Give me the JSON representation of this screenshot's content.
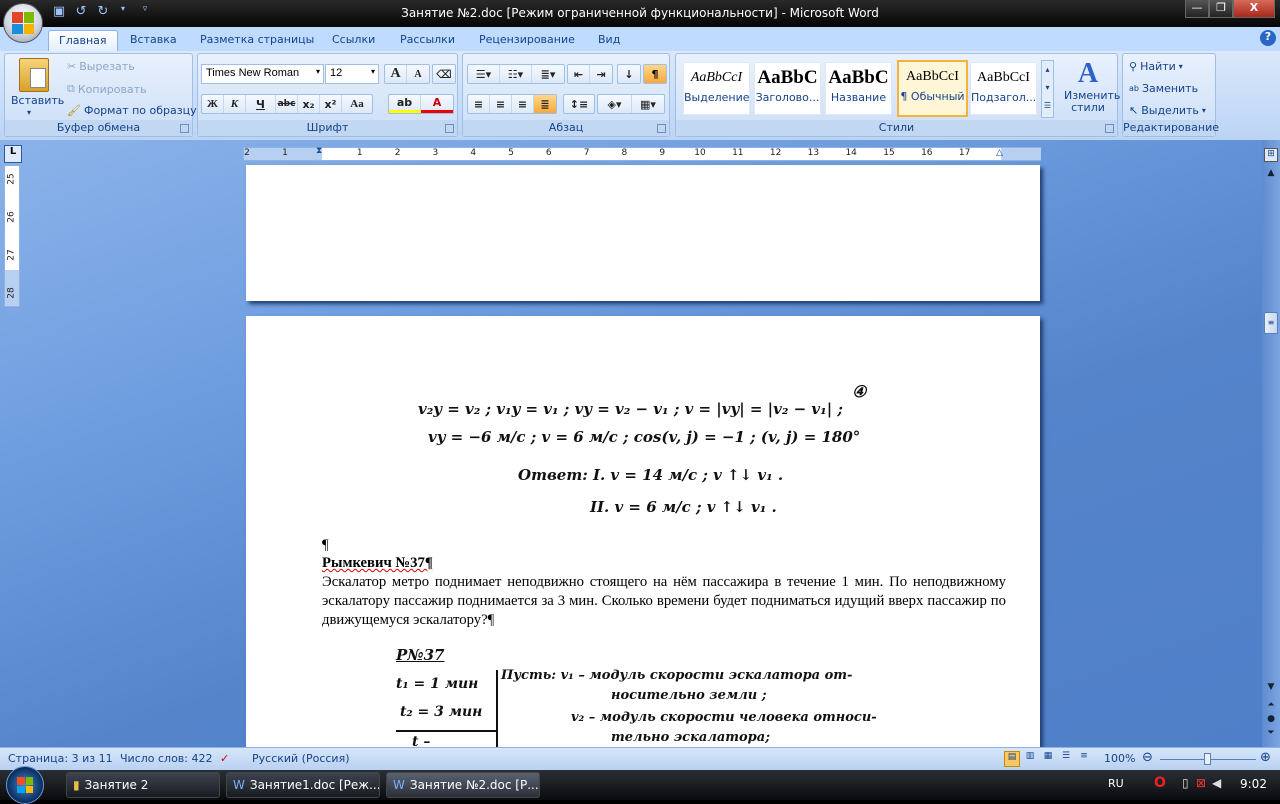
{
  "window": {
    "title": "Занятие №2.doc [Режим ограниченной функциональности] - Microsoft Word",
    "minimize": "—",
    "restore": "❐",
    "close": "X"
  },
  "tabs": [
    "Главная",
    "Вставка",
    "Разметка страницы",
    "Ссылки",
    "Рассылки",
    "Рецензирование",
    "Вид"
  ],
  "clipboard": {
    "label": "Буфер обмена",
    "paste": "Вставить",
    "cut": "Вырезать",
    "copy": "Копировать",
    "format_painter": "Формат по образцу"
  },
  "font": {
    "label": "Шрифт",
    "name": "Times New Roman",
    "size": "12",
    "bold": "Ж",
    "italic": "К",
    "underline": "Ч",
    "strike": "abc",
    "sub": "x₂",
    "sup": "x²",
    "case": "Aa",
    "grow": "A",
    "shrink": "A",
    "color": "A"
  },
  "paragraph": {
    "label": "Абзац",
    "pilcrow": "¶"
  },
  "styles": {
    "label": "Стили",
    "items": [
      {
        "preview": "AaBbCcI",
        "name": "Выделение"
      },
      {
        "preview": "AaBbC",
        "name": "Заголово..."
      },
      {
        "preview": "AaBbC",
        "name": "Название"
      },
      {
        "preview": "AaBbCcI",
        "name": "¶ Обычный"
      },
      {
        "preview": "AaBbCcI",
        "name": "Подзагол..."
      }
    ],
    "selected_index": 3,
    "change": "Изменить стили"
  },
  "editing": {
    "label": "Редактирование",
    "find": "Найти",
    "replace": "Заменить",
    "select": "Выделить"
  },
  "ruler": {
    "left": [
      "2",
      "1"
    ],
    "right": [
      "1",
      "2",
      "3",
      "4",
      "5",
      "6",
      "7",
      "8",
      "9",
      "10",
      "11",
      "12",
      "13",
      "14",
      "15",
      "16",
      "17"
    ],
    "vertical": [
      "25",
      "26",
      "27",
      "28"
    ],
    "tab_selector": "L"
  },
  "document": {
    "handwritten1": [
      "v₂y = v₂ ;  v₁y = v₁ ;  vy = v₂ − v₁ ;  v = |vy| = |v₂ − v₁| ;",
      "vy = −6 м/с ;  v = 6 м/с ;  cos(v, j) = −1 ;  (v, j) = 180°",
      "Ответ:  I.  v = 14 м/с ;  v ↑↓ v₁ .",
      "II.  v = 6 м/с ;  v ↑↓ v₁ ."
    ],
    "handwritten_mark": "④",
    "pilcrow": "¶",
    "heading": "Рымкевич №37¶",
    "paragraph": "Эскалатор метро поднимает неподвижно стоящего на нём пассажира в течение 1 мин. По неподвижному эскалатору пассажир поднимается за 3 мин. Сколько времени будет подниматься идущий вверх пассажир по движущемуся эскалатору?¶",
    "handwritten2": {
      "title": "Р№37",
      "given": [
        "t₁ = 1 мин",
        "t₂ = 3 мин",
        "t –"
      ],
      "lines": [
        "Пусть: v₁ – модуль скорости эскалатора от-",
        "носительно земли ;",
        "v₂ – модуль скорости человека относи-",
        "тельно эскалатора;"
      ]
    }
  },
  "status": {
    "page": "Страница: 3 из 11",
    "words": "Число слов: 422",
    "language": "Русский (Россия)",
    "zoom": "100%",
    "zoom_percent": 100
  },
  "taskbar": {
    "items": [
      "Занятие 2",
      "Занятие1.doc [Реж...",
      "Занятие №2.doc [Р..."
    ],
    "lang": "RU",
    "time": "9:02"
  }
}
